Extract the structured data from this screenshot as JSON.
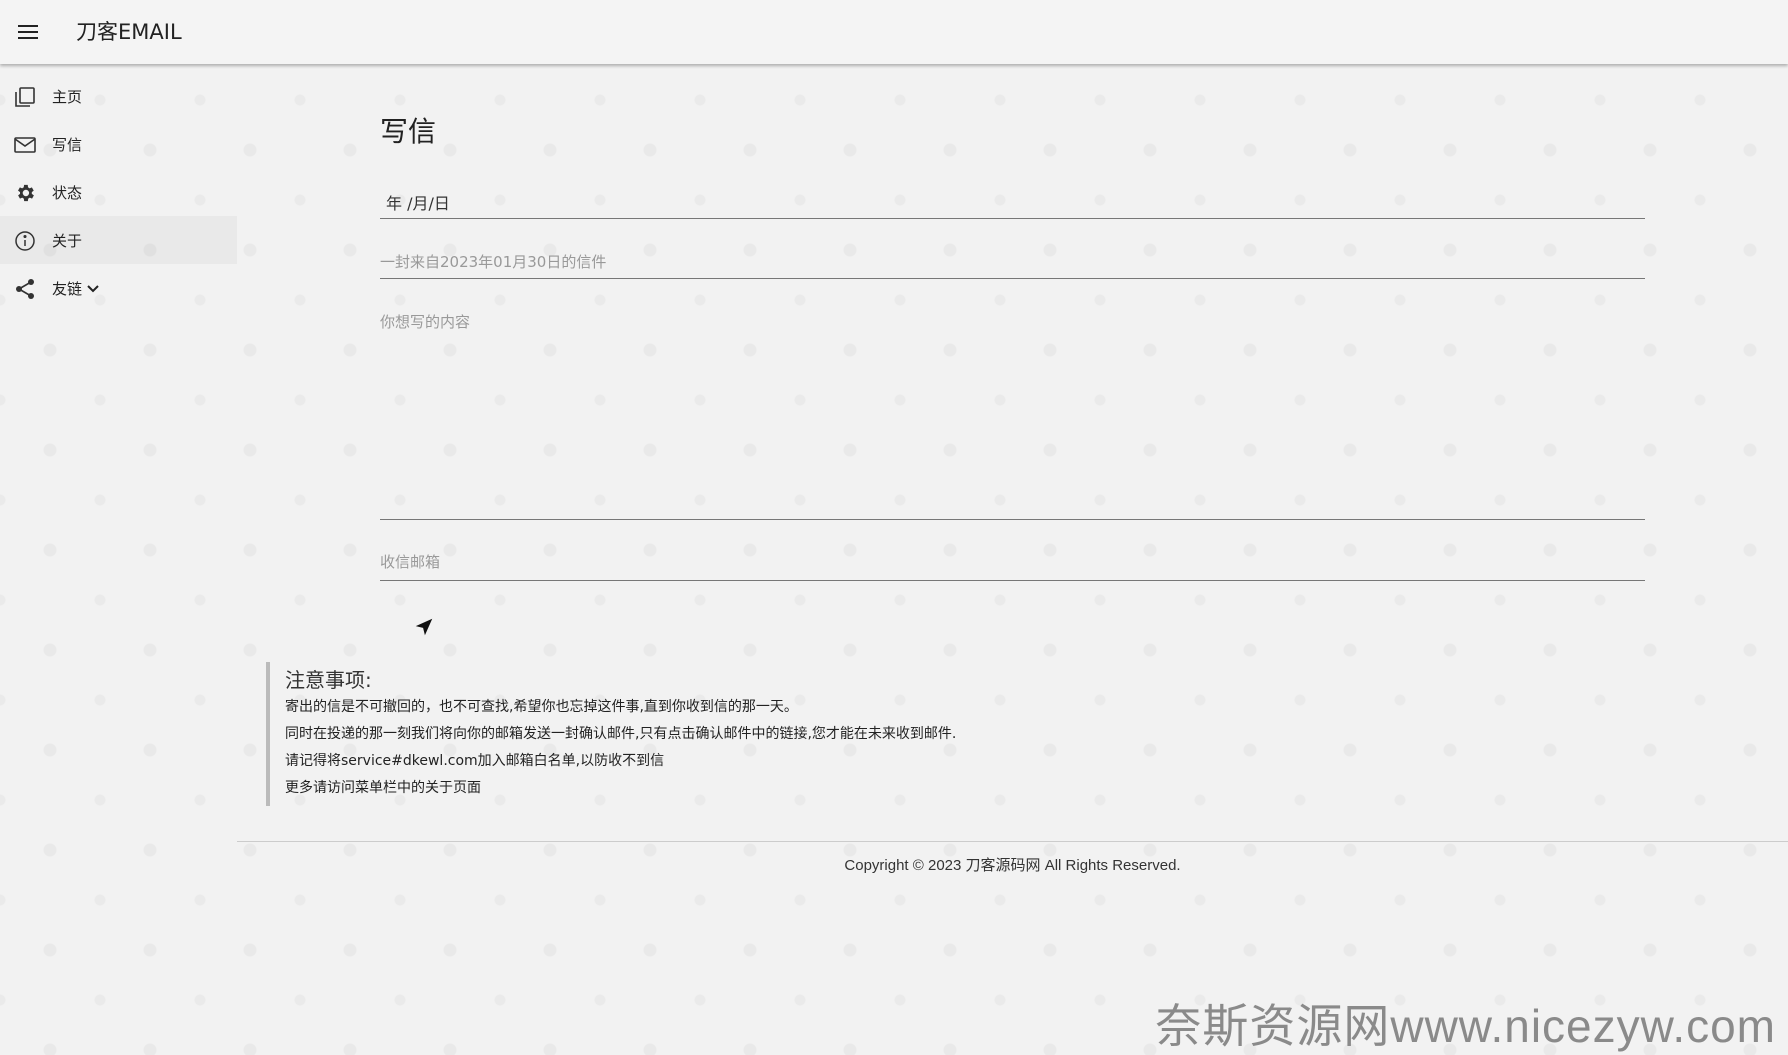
{
  "app": {
    "title": "刀客EMAIL"
  },
  "sidebar": {
    "items": [
      {
        "label": "主页",
        "icon": "copy-icon"
      },
      {
        "label": "写信",
        "icon": "mail-icon"
      },
      {
        "label": "状态",
        "icon": "gear-icon"
      },
      {
        "label": "关于",
        "icon": "info-icon"
      },
      {
        "label": "友链",
        "icon": "share-icon"
      }
    ]
  },
  "compose": {
    "title": "写信",
    "date_placeholder": "年 /月/日",
    "subject_placeholder": "一封来自2023年01月30日的信件",
    "content_placeholder": "你想写的内容",
    "email_placeholder": "收信邮箱",
    "send_icon": "send-icon"
  },
  "notice": {
    "title": "注意事项:",
    "lines": [
      "寄出的信是不可撤回的，也不可查找,希望你也忘掉这件事,直到你收到信的那一天。",
      "同时在投递的那一刻我们将向你的邮箱发送一封确认邮件,只有点击确认邮件中的链接,您才能在未来收到邮件.",
      "请记得将service#dkewl.com加入邮箱白名单,以防收不到信",
      "更多请访问菜单栏中的关于页面"
    ]
  },
  "footer": {
    "copyright": "Copyright © 2023 刀客源码网 All Rights Reserved."
  },
  "watermark": {
    "text": "奈斯资源网www.nicezyw.com"
  },
  "colors": {
    "background": "#f2f2f2",
    "text": "#222222",
    "placeholder": "#999999",
    "divider": "#777777"
  }
}
